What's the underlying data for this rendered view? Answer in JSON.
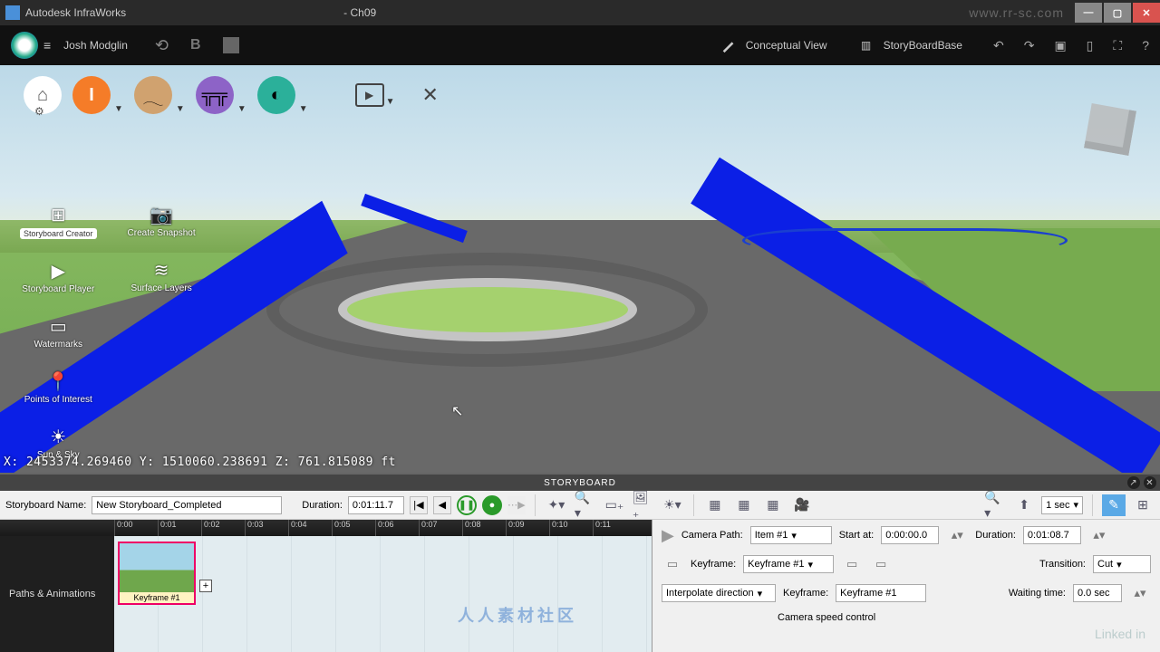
{
  "titlebar": {
    "app": "Autodesk InfraWorks",
    "doc": "- Ch09",
    "watermark": "www.rr-sc.com"
  },
  "header": {
    "user": "Josh Modglin",
    "conceptual": "Conceptual View",
    "storyboard_base": "StoryBoardBase"
  },
  "sidetools": {
    "left": [
      {
        "label": "Storyboard Creator",
        "icon": "⊞"
      },
      {
        "label": "Storyboard Player",
        "icon": "▶"
      },
      {
        "label": "Watermarks",
        "icon": "▭"
      },
      {
        "label": "Points of Interest",
        "icon": "📍"
      },
      {
        "label": "Sun & Sky",
        "icon": "☀"
      }
    ],
    "right": [
      {
        "label": "Create Snapshot",
        "icon": "📷"
      },
      {
        "label": "Surface Layers",
        "icon": "≋"
      }
    ]
  },
  "coords": "X: 2453374.269460 Y: 1510060.238691 Z: 761.815089 ft",
  "sb": {
    "title": "STORYBOARD",
    "name_label": "Storyboard Name:",
    "name_value": "New Storyboard_Completed",
    "duration_label": "Duration:",
    "duration_value": "0:01:11.7",
    "speed": "1 sec",
    "ruler": [
      "0:00",
      "0:01",
      "0:02",
      "0:03",
      "0:04",
      "0:05",
      "0:06",
      "0:07",
      "0:08",
      "0:09",
      "0:10",
      "0:11"
    ],
    "track_label": "Paths & Animations",
    "keyframe_caption": "Keyframe #1",
    "props": {
      "camera_path_label": "Camera Path:",
      "camera_path": "Item #1",
      "start_label": "Start at:",
      "start": "0:00:00.0",
      "dur_label": "Duration:",
      "dur": "0:01:08.7",
      "keyframe_label": "Keyframe:",
      "keyframe_sel": "Keyframe #1",
      "transition_label": "Transition:",
      "transition": "Cut",
      "interp": "Interpolate direction",
      "keyframe2_label": "Keyframe:",
      "keyframe2": "Keyframe #1",
      "wait_label": "Waiting time:",
      "wait": "0.0 sec",
      "speed_control": "Camera speed control"
    }
  },
  "center_wm": "人人素材社区",
  "linkedin": "Linked in"
}
